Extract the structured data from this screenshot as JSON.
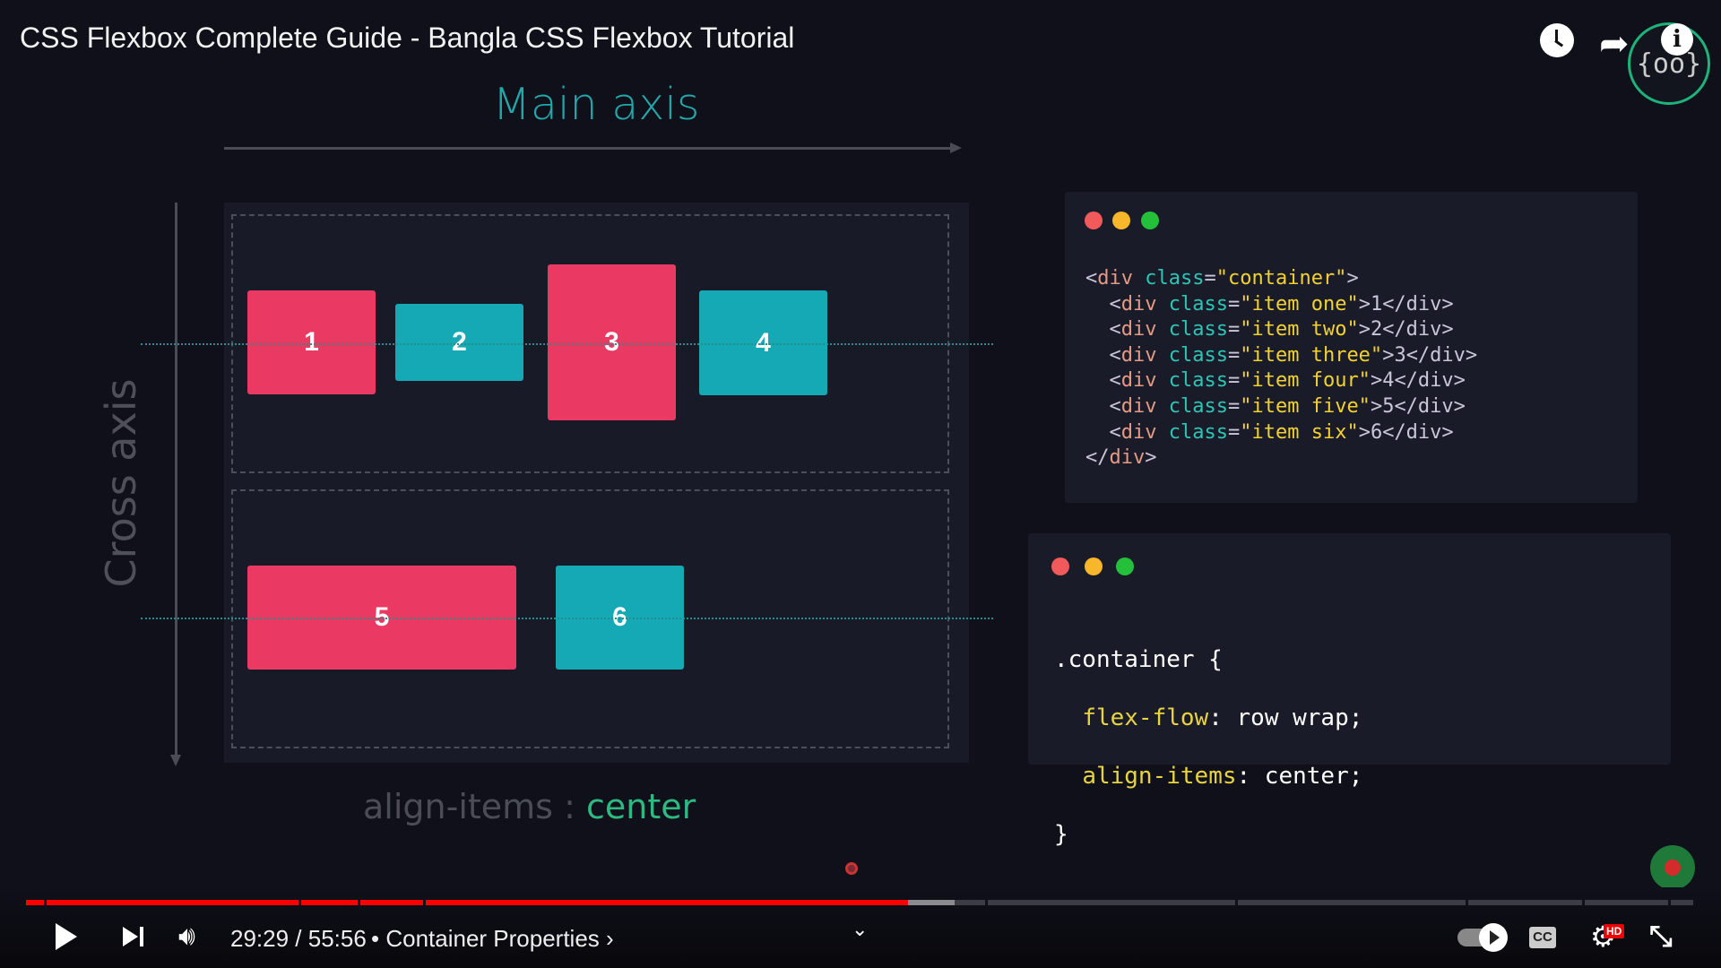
{
  "video": {
    "title": "CSS Flexbox Complete Guide - Bangla CSS Flexbox Tutorial"
  },
  "slide": {
    "main_axis": "Main axis",
    "cross_axis": "Cross axis",
    "items": [
      "1",
      "2",
      "3",
      "4",
      "5",
      "6"
    ],
    "caption_prop": "align-items",
    "caption_sep": ":",
    "caption_value": "center",
    "html_code": [
      [
        "<",
        "div",
        " class",
        "=",
        "\"container\"",
        ">",
        "",
        ""
      ],
      [
        "  <",
        "div",
        " class",
        "=",
        "\"item one\"",
        ">",
        "1",
        "</div>"
      ],
      [
        "  <",
        "div",
        " class",
        "=",
        "\"item two\"",
        ">",
        "2",
        "</div>"
      ],
      [
        "  <",
        "div",
        " class",
        "=",
        "\"item three\"",
        ">",
        "3",
        "</div>"
      ],
      [
        "  <",
        "div",
        " class",
        "=",
        "\"item four\"",
        ">",
        "4",
        "</div>"
      ],
      [
        "  <",
        "div",
        " class",
        "=",
        "\"item five\"",
        ">",
        "5",
        "</div>"
      ],
      [
        "  <",
        "div",
        " class",
        "=",
        "\"item six\"",
        ">",
        "6",
        "</div>"
      ],
      [
        "</",
        "div",
        ">",
        "",
        "",
        "",
        "",
        ""
      ]
    ],
    "css_code": {
      "selector": ".container {",
      "p1": "flex-flow",
      "v1": ": row wrap;",
      "p2": "align-items",
      "v2": ": center;",
      "close": "}"
    }
  },
  "player": {
    "time": "29:29 / 55:56",
    "chapter": "• Container Properties",
    "chapter_arrow": "›",
    "hd": "HD",
    "cc": "CC",
    "progress_percent": 52.9,
    "buffered_percent": 55.7,
    "colors": {
      "progress": "#ff0000",
      "accent": "#22a8ab"
    }
  }
}
